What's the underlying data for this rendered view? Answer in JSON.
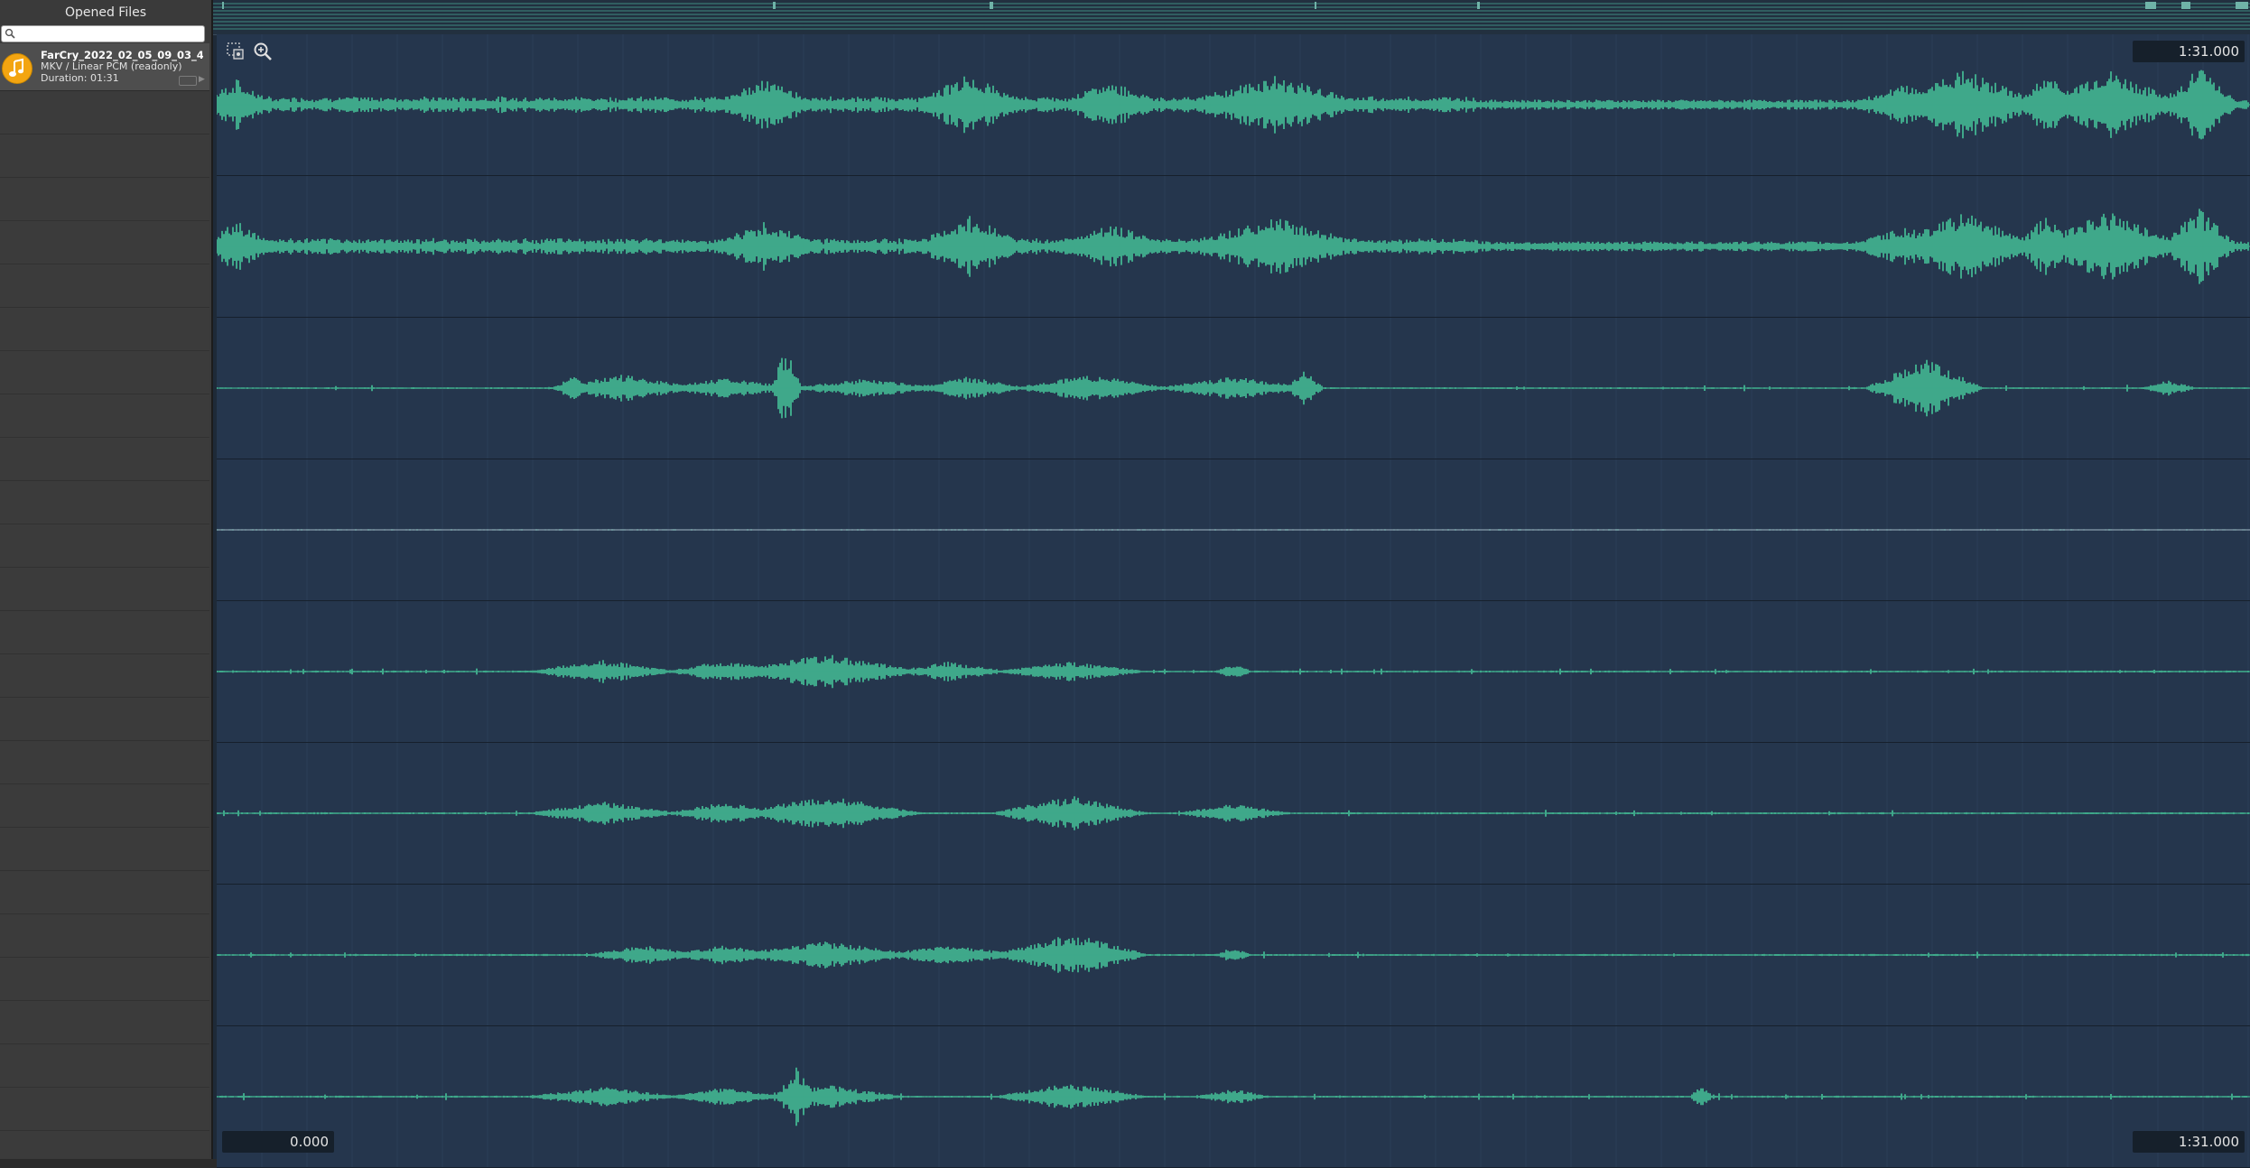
{
  "sidebar": {
    "title": "Opened Files",
    "search_placeholder": "",
    "files": [
      {
        "name": "FarCry_2022_02_05_09_03_44...",
        "format": "MKV / Linear PCM (readonly)",
        "duration": "Duration: 01:31"
      }
    ]
  },
  "viewer": {
    "time_end_top": "1:31.000",
    "time_start": "0.000",
    "time_end_bottom": "1:31.000",
    "channel_count": 8
  },
  "colors": {
    "waveform": "#3fa88a",
    "channel_bg": "#25364d",
    "file_icon": "#f3a511"
  },
  "icons": [
    "search-icon",
    "audio-file-icon",
    "selection-tool-icon",
    "zoom-in-icon"
  ]
}
